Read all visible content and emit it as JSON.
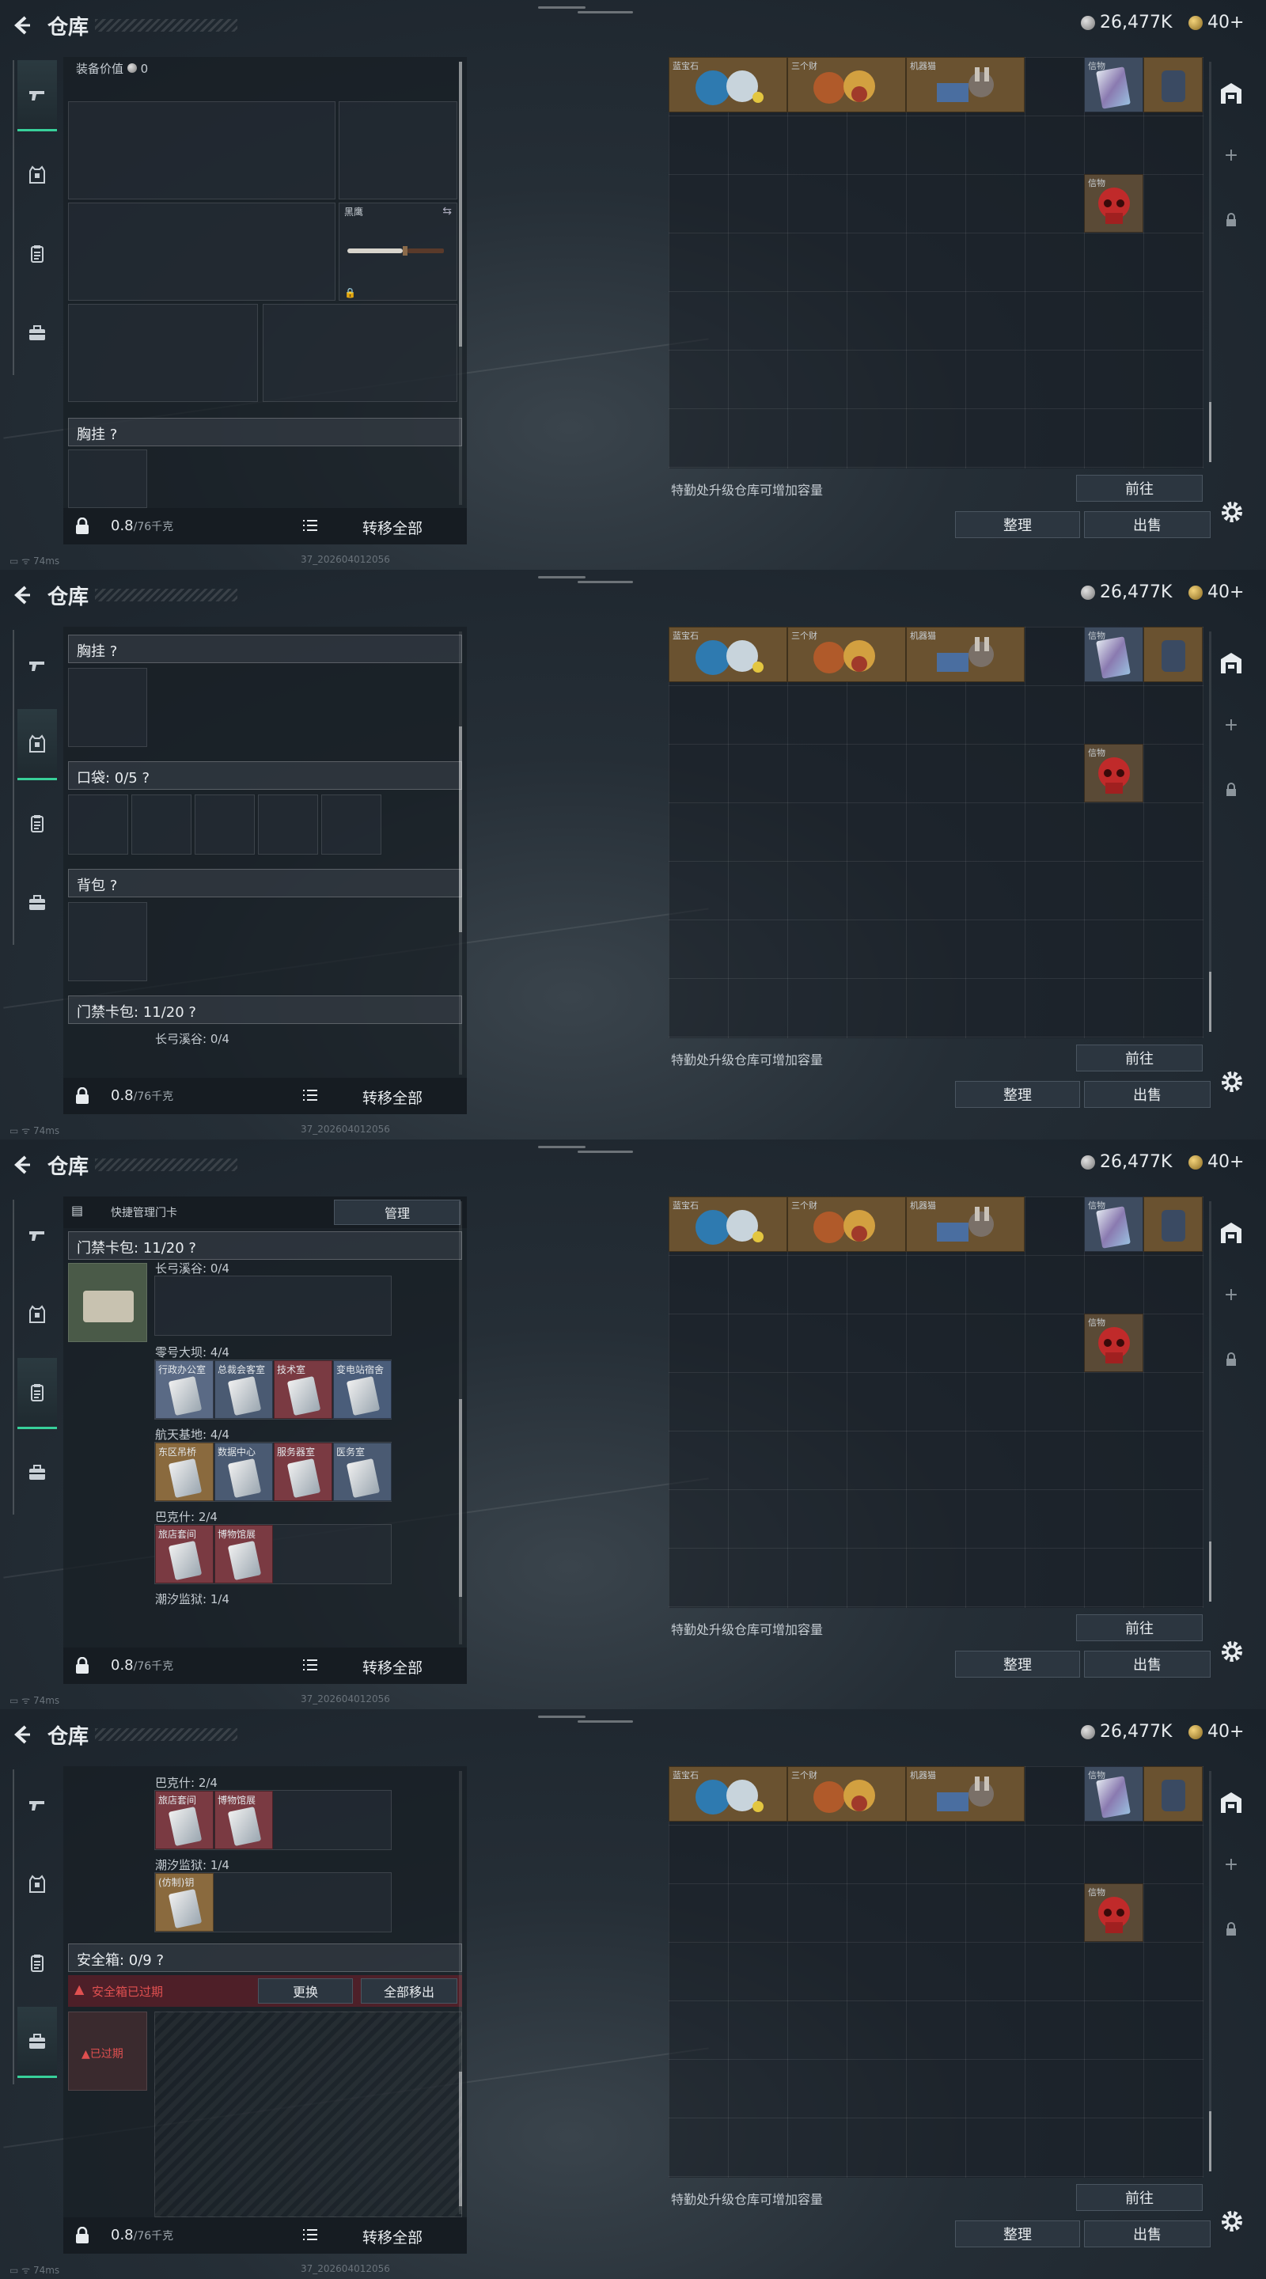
{
  "header": {
    "title": "仓库",
    "currency_silver": "26,477K",
    "currency_gold": "40+"
  },
  "nav": {
    "items": [
      "weapon",
      "armor",
      "keycard",
      "briefcase"
    ]
  },
  "loadout": {
    "equip_value_label": "装备价值",
    "equip_value": "0",
    "knife_name": "黑鹰",
    "chest_rig": "胸挂",
    "pockets": "口袋: 0/5",
    "backpack": "背包",
    "card_pack": "门禁卡包: 11/20",
    "help": "?",
    "quick_manage": "快捷管理门卡",
    "manage": "管理",
    "safe_box": "安全箱: 0/9",
    "safe_expired": "安全箱已过期",
    "replace": "更换",
    "remove_all": "全部移出",
    "expired_tag": "已过期"
  },
  "maps": [
    {
      "name": "长弓溪谷: 0/4",
      "cards": []
    },
    {
      "name": "零号大坝: 4/4",
      "cards": [
        {
          "label": "行政办公室",
          "color": "#5a6a85"
        },
        {
          "label": "总裁会客室",
          "color": "#4a5a72"
        },
        {
          "label": "技术室",
          "color": "#7a3a42"
        },
        {
          "label": "变电站宿舍",
          "color": "#4a5d7a"
        }
      ]
    },
    {
      "name": "航天基地: 4/4",
      "cards": [
        {
          "label": "东区吊桥",
          "color": "#8a6a3e"
        },
        {
          "label": "数据中心",
          "color": "#4a5a72"
        },
        {
          "label": "服务器室",
          "color": "#7a3a42"
        },
        {
          "label": "医务室",
          "color": "#4a5a72"
        }
      ]
    },
    {
      "name": "巴克什: 2/4",
      "cards": [
        {
          "label": "旅店套间",
          "color": "#7a3a42"
        },
        {
          "label": "博物馆展",
          "color": "#7a3a42"
        }
      ]
    },
    {
      "name": "潮汐监狱: 1/4",
      "cards": [
        {
          "label": "(仿制)钥",
          "color": "#8a6a3e"
        }
      ]
    }
  ],
  "footer": {
    "weight": "0.8",
    "weight_cap": "/76千克",
    "move_all": "转移全部",
    "ping": "74ms",
    "build": "37_202604012056"
  },
  "stash": {
    "hint": "特勤处升级仓库可增加容量",
    "goto": "前往",
    "sort": "整理",
    "sell": "出售",
    "item_labels": [
      "蓝宝石",
      "三个财",
      "机器猫",
      "信物"
    ]
  }
}
